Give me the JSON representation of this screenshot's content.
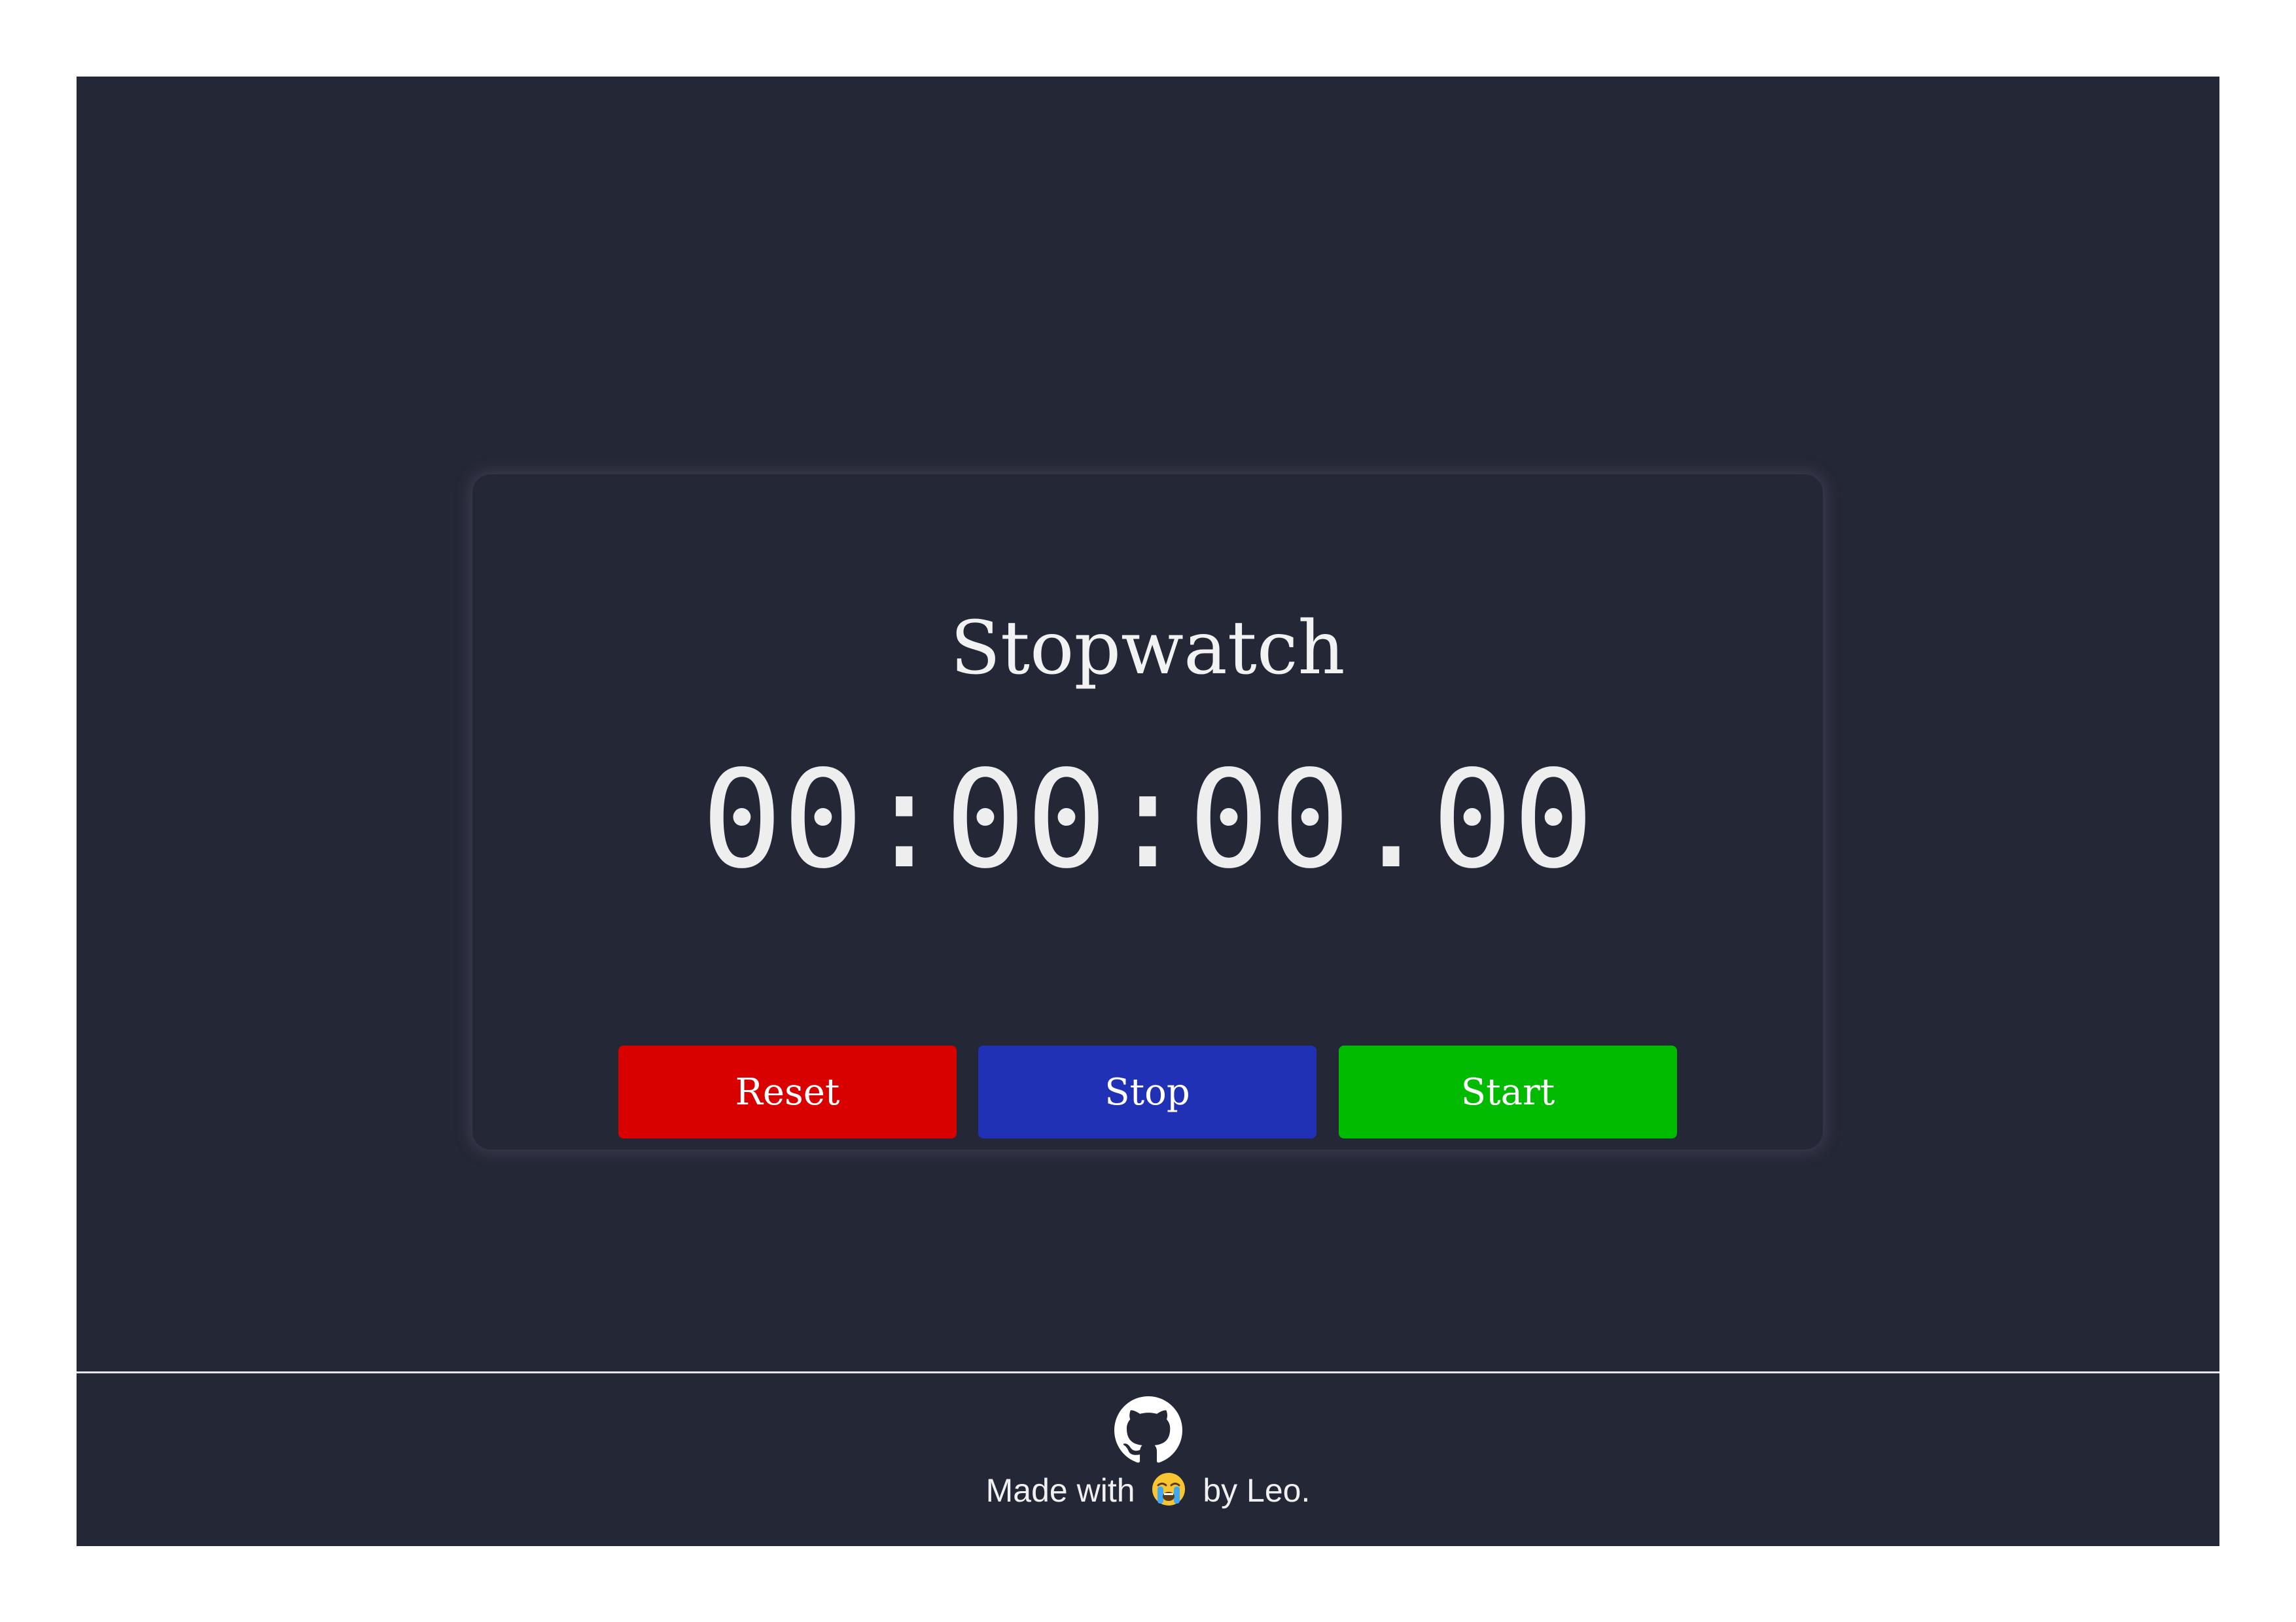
{
  "card": {
    "title": "Stopwatch",
    "time": "00:00:00.00"
  },
  "buttons": {
    "reset_label": "Reset",
    "stop_label": "Stop",
    "start_label": "Start"
  },
  "footer": {
    "icon": "github-icon",
    "made_with": "Made with",
    "emoji_icon": "loudly-crying-face-emoji",
    "by": "by Leo."
  },
  "colors": {
    "background": "#242736",
    "reset": "#d90000",
    "stop": "#2131b5",
    "start": "#00bb00",
    "text": "#f2f2f2"
  }
}
